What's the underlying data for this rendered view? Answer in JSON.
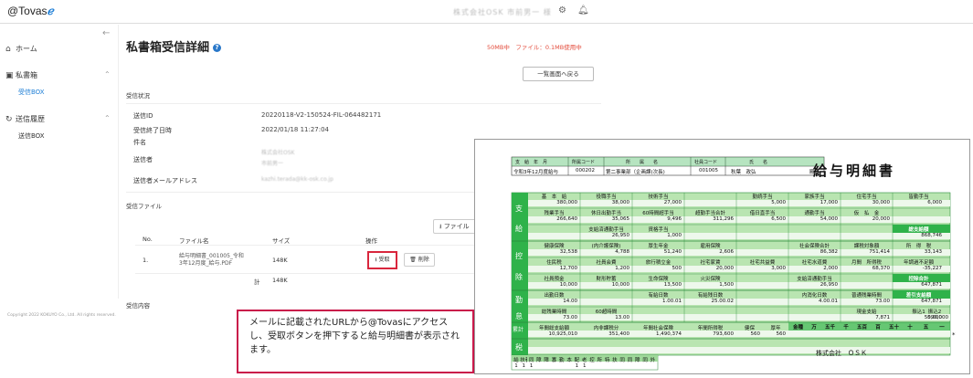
{
  "header": {
    "logo": "@Tovas",
    "company": "株式会社OSK 市前男一 様",
    "gear_icon": "gear-icon",
    "bell_icon": "bell-icon"
  },
  "sidebar": {
    "collapse": "←",
    "home": "ホーム",
    "inbox": "私書箱",
    "inbox_sub": "受信BOX",
    "sent": "送信履歴",
    "sent_sub": "送信BOX",
    "copyright": "Copyright 2022 KOKUYO Co., Ltd. All rights reserved."
  },
  "main": {
    "title": "私書箱受信詳細",
    "limit": "50MB中　ファイル：0.1MB使用中",
    "back_button": "一覧画面へ戻る",
    "section_status": "受信状況",
    "rows": [
      {
        "label": "送信ID",
        "value": "20220118-V2-150524-FIL-064482171"
      },
      {
        "label": "受信終了日時",
        "value": "2022/01/18 11:27:04"
      },
      {
        "label": "件名",
        "value": ""
      },
      {
        "label": "送信者",
        "value": "株式会社OSK"
      },
      {
        "label": "",
        "value": "市前男一"
      },
      {
        "label": "送信者メールアドレス",
        "value": "kazhi.terada@kk-osk.co.jp"
      }
    ],
    "section_files": "受信ファイル",
    "file_button": "ファイル",
    "table_headers": {
      "no": "No.",
      "name": "ファイル名",
      "size": "サイズ",
      "op": "操作"
    },
    "file_row": {
      "no": "1.",
      "name_line1": "給与明細書_001005_令和",
      "name_line2": "3年12月度_給与.PDF",
      "size": "148K",
      "receive": "受取",
      "delete": "削除"
    },
    "total_label": "計",
    "total_value": "148K",
    "section_content": "受信内容"
  },
  "callout": {
    "text": "メールに記載されたURLから@Tovasにアクセスし、受取ボタンを押下すると給与明細書が表示されます。"
  },
  "slip": {
    "title": "給与明細書",
    "head_labels": [
      "支　給　年　月",
      "所属コード",
      "所　　属　　名",
      "社員コード",
      "氏　　名"
    ],
    "head_values": [
      "令和3年12月度給与",
      "000202",
      "第二事業部（企画課(次長)",
      "001005",
      "秋葉　政弘",
      "殿"
    ],
    "side_labels": [
      "支",
      "給",
      "控",
      "除",
      "勤",
      "怠",
      "累計",
      "税"
    ],
    "pay_row1_labels": [
      "基　本　給",
      "役職手当",
      "技術手当",
      "",
      "勤続手当",
      "家族手当",
      "住宅手当",
      "皆勤手当"
    ],
    "pay_row1_values": [
      "380,000",
      "38,000",
      "27,000",
      "",
      "5,000",
      "17,000",
      "30,000",
      "6,000"
    ],
    "pay_row2_labels": [
      "残業手当",
      "休日出勤手当",
      "60時間超手当",
      "超勤手当合計",
      "借日直手当",
      "通勤手当",
      "仮　払　金",
      ""
    ],
    "pay_row2_values": [
      "266,640",
      "35,065",
      "9,496",
      "311,296",
      "6,500",
      "54,000",
      "20,000",
      ""
    ],
    "pay_row3_labels": [
      "",
      "支給済通勤手当",
      "資格手当",
      "",
      "",
      "",
      "",
      "総支給額"
    ],
    "pay_row3_values": [
      "",
      "26,950",
      "1,000",
      "",
      "",
      "",
      "",
      "868,746"
    ],
    "ded_row1_labels": [
      "健康保険",
      "(内介護保険)",
      "厚生年金",
      "雇用保険",
      "",
      "社会保険合計",
      "課税対象額",
      "所　得　税"
    ],
    "ded_row1_values": [
      "32,538",
      "4,788",
      "51,240",
      "2,606",
      "",
      "86,382",
      "751,414",
      "33,143"
    ],
    "ded_row2_labels": [
      "住民税",
      "社員会費",
      "旅行積立金",
      "社宅家賃",
      "社宅共益費",
      "社宅水道費",
      "月間　所得税",
      "年調過不足額"
    ],
    "ded_row2_values": [
      "12,700",
      "1,200",
      "500",
      "20,000",
      "3,000",
      "2,000",
      "68,370",
      "-35,227"
    ],
    "ded_row3_labels": [
      "社員預金",
      "財形貯蓄",
      "生命保険",
      "火災保険",
      "",
      "支給済通勤手当",
      "",
      "控除合計"
    ],
    "ded_row3_values": [
      "10,000",
      "10,000",
      "13,500",
      "1,500",
      "",
      "26,950",
      "",
      "647,871"
    ],
    "att_row1_labels": [
      "出勤日数",
      "",
      "有給日数",
      "有給残日数",
      "",
      "内消化日数",
      "普通残業時間",
      "差引支給額"
    ],
    "att_row1_values": [
      "14.00",
      "",
      "1.00.01",
      "25.00.02",
      "",
      "4.00.01",
      "73.00",
      "647,871"
    ],
    "att_row2_labels": [
      "総残業時間",
      "60超時間",
      "",
      "",
      "",
      "",
      "現金支給",
      "振込1"
    ],
    "att_row2_values": [
      "73.00",
      "13.00",
      "",
      "",
      "",
      "",
      "7,871",
      "50,000"
    ],
    "att_row2_extra": [
      "振込2",
      "590,000"
    ],
    "cum_labels": [
      "年間総支給額",
      "内非課税分",
      "年間社会保険",
      "年間所得税",
      "健保",
      "厚年"
    ],
    "cum_values": [
      "10,925,010",
      "351,400",
      "1,490,374",
      "793,600",
      "560",
      "560"
    ],
    "denom_labels": [
      "金種",
      "万",
      "五千",
      "千",
      "五百",
      "百",
      "五十",
      "十",
      "五",
      "一"
    ],
    "tax_labels": [
      "給",
      "扶養",
      "同",
      "障",
      "障",
      "寡",
      "勤",
      "本",
      "配",
      "老",
      "控",
      "所",
      "特",
      "扶",
      "同",
      "同",
      "障",
      "同",
      "外"
    ],
    "tax_values": [
      "1",
      "1",
      "1",
      "",
      "",
      "",
      "",
      "",
      "1",
      "1",
      "",
      "",
      "",
      "",
      "",
      ""
    ],
    "company": "株式会社　ＯＳＫ",
    "asterisk": "*"
  }
}
